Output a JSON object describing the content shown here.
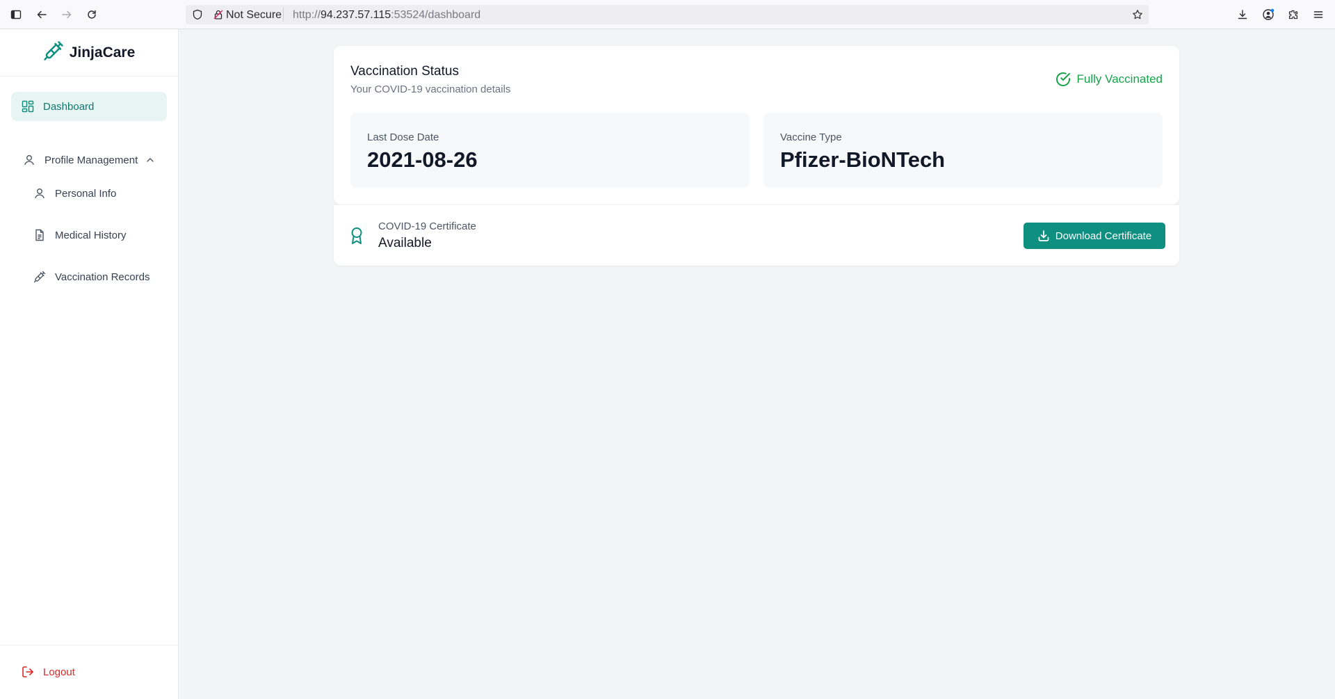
{
  "browser": {
    "url_prefix": "http://",
    "url_host": "94.237.57.115",
    "url_rest": ":53524/dashboard",
    "security_label": "Not Secure"
  },
  "sidebar": {
    "brand": "JinjaCare",
    "items": [
      {
        "label": "Dashboard",
        "icon": "dashboard-icon",
        "active": true
      },
      {
        "label": "Profile Management",
        "icon": "user-icon",
        "expanded": true
      },
      {
        "label": "Personal Info",
        "icon": "user-icon"
      },
      {
        "label": "Medical History",
        "icon": "document-icon"
      },
      {
        "label": "Vaccination Records",
        "icon": "syringe-icon"
      }
    ],
    "logout": "Logout"
  },
  "vaccination": {
    "title": "Vaccination Status",
    "subtitle": "Your COVID-19 vaccination details",
    "status": "Fully Vaccinated",
    "last_dose_label": "Last Dose Date",
    "last_dose_value": "2021-08-26",
    "vaccine_type_label": "Vaccine Type",
    "vaccine_type_value": "Pfizer-BioNTech"
  },
  "certificate": {
    "label": "COVID-19 Certificate",
    "value": "Available",
    "button": "Download Certificate"
  },
  "colors": {
    "accent": "#0f8f80",
    "success": "#16a34a",
    "danger": "#dc2626"
  }
}
